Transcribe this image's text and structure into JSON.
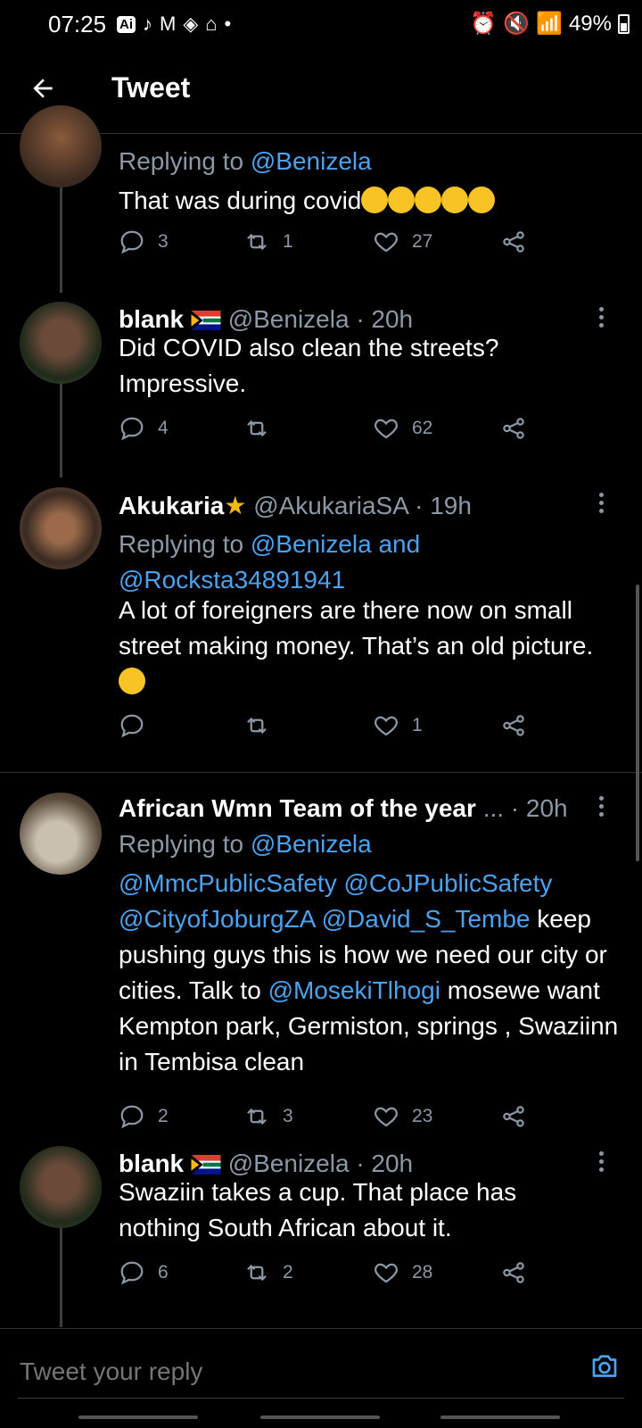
{
  "status_bar": {
    "time": "07:25",
    "ai_badge": "Ai",
    "battery": "49%"
  },
  "app_bar": {
    "title": "Tweet"
  },
  "tweets": [
    {
      "replying_prefix": "Replying to ",
      "replying_to": "@Benizela",
      "text": "That was during covid",
      "emoji_count": 5,
      "replies": "3",
      "retweets": "1",
      "likes": "27"
    },
    {
      "name": "blank",
      "handle_time": "@Benizela · 20h",
      "text": "Did COVID also clean the streets? Impressive.",
      "replies": "4",
      "retweets": "",
      "likes": "62"
    },
    {
      "name": "Akukaria",
      "handle_time": "@AkukariaSA · 19h",
      "replying_prefix": "Replying to ",
      "replying_to": "@Benizela and @Rocksta34891941",
      "text": "A lot of foreigners are there now on small street making money. That’s an old picture.",
      "replies": "",
      "retweets": "",
      "likes": "1"
    },
    {
      "name": "African Wmn Team of the year",
      "handle_time": "... · 20h",
      "replying_prefix": "Replying to ",
      "replying_to": "@Benizela",
      "mentions": "@MmcPublicSafety @CoJPublicSafety @CityofJoburgZA @David_S_Tembe",
      "text_after_mentions": " keep pushing guys this is how we need our city or cities. Talk to ",
      "mention2": "@MosekiTlhogi",
      "text_end": " mosewe want Kempton park, Germiston, springs , Swaziinn in Tembisa clean",
      "replies": "2",
      "retweets": "3",
      "likes": "23"
    },
    {
      "name": "blank",
      "handle_time": "@Benizela · 20h",
      "text": "Swaziin takes a cup. That place has nothing South African about it.",
      "replies": "6",
      "retweets": "2",
      "likes": "28"
    }
  ],
  "reply_bar": {
    "placeholder": "Tweet your reply"
  },
  "colors": {
    "background": "#000000",
    "link": "#4aa3f0",
    "muted": "#8b98a5",
    "divider": "#2f3336"
  }
}
